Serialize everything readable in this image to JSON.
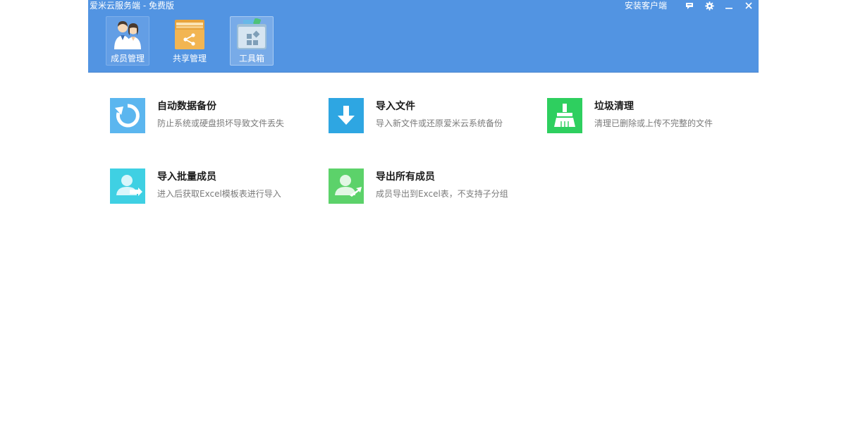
{
  "window": {
    "title": "爱米云服务端 - 免费版",
    "install_client": "安装客户端"
  },
  "nav": {
    "members": "成员管理",
    "share": "共享管理",
    "toolbox": "工具箱"
  },
  "tools": [
    {
      "title": "自动数据备份",
      "desc": "防止系统或硬盘损坏导致文件丢失",
      "icon": "backup-refresh-icon",
      "color": "#5bb6ef"
    },
    {
      "title": "导入文件",
      "desc": "导入新文件或还原爱米云系统备份",
      "icon": "download-arrow-icon",
      "color": "#2ea6e2"
    },
    {
      "title": "垃圾清理",
      "desc": "清理已删除或上传不完整的文件",
      "icon": "broom-icon",
      "color": "#2ecf5f"
    },
    {
      "title": "导入批量成员",
      "desc": "进入后获取Excel模板表进行导入",
      "icon": "import-members-icon",
      "color": "#3fd0e3"
    },
    {
      "title": "导出所有成员",
      "desc": "成员导出到Excel表，不支持子分组",
      "icon": "export-members-icon",
      "color": "#5cd26a"
    }
  ],
  "colors": {
    "header": "#5294e2",
    "title_text": "#1a1a1a",
    "desc_text": "#7a7a7a"
  }
}
